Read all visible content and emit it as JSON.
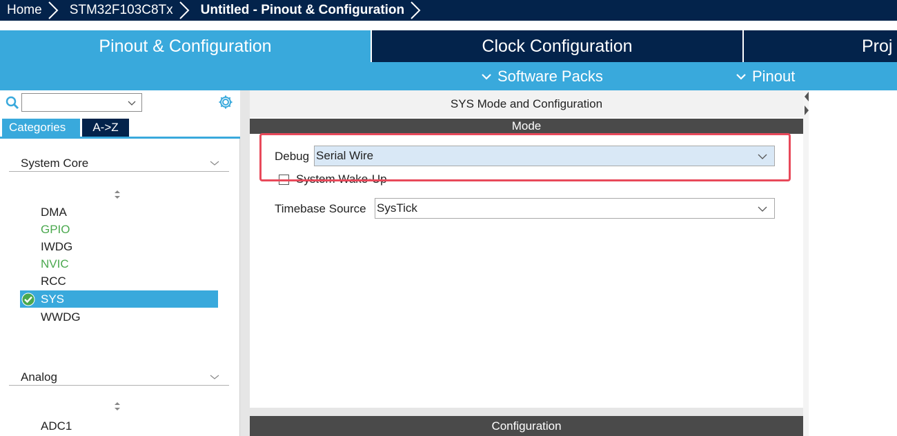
{
  "breadcrumb": {
    "home": "Home",
    "device": "STM32F103C8Tx",
    "current": "Untitled - Pinout & Configuration"
  },
  "tabs": {
    "pinout": "Pinout & Configuration",
    "clock": "Clock Configuration",
    "project": "Proj"
  },
  "subbar": {
    "software_packs": "Software Packs",
    "pinout": "Pinout"
  },
  "left": {
    "search": {
      "value": "",
      "placeholder": ""
    },
    "view_tabs": {
      "categories": "Categories",
      "az": "A->Z"
    },
    "sections": [
      {
        "label": "System Core",
        "items": [
          {
            "label": "DMA",
            "state": "normal"
          },
          {
            "label": "GPIO",
            "state": "configured"
          },
          {
            "label": "IWDG",
            "state": "normal"
          },
          {
            "label": "NVIC",
            "state": "configured"
          },
          {
            "label": "RCC",
            "state": "normal"
          },
          {
            "label": "SYS",
            "state": "selected"
          },
          {
            "label": "WWDG",
            "state": "normal"
          }
        ]
      },
      {
        "label": "Analog",
        "items": [
          {
            "label": "ADC1",
            "state": "normal"
          }
        ]
      }
    ]
  },
  "content": {
    "title": "SYS Mode and Configuration",
    "mode_header": "Mode",
    "debug": {
      "label": "Debug",
      "value": "Serial Wire"
    },
    "wakeup": {
      "label": "System Wake-Up",
      "checked": false
    },
    "timebase": {
      "label": "Timebase Source",
      "value": "SysTick"
    },
    "config_header": "Configuration"
  },
  "colors": {
    "navy": "#03234b",
    "accent": "#39a9dc",
    "configured": "#4aa84e",
    "highlight": "#e8495a",
    "header_gray": "#4a4a4a"
  }
}
